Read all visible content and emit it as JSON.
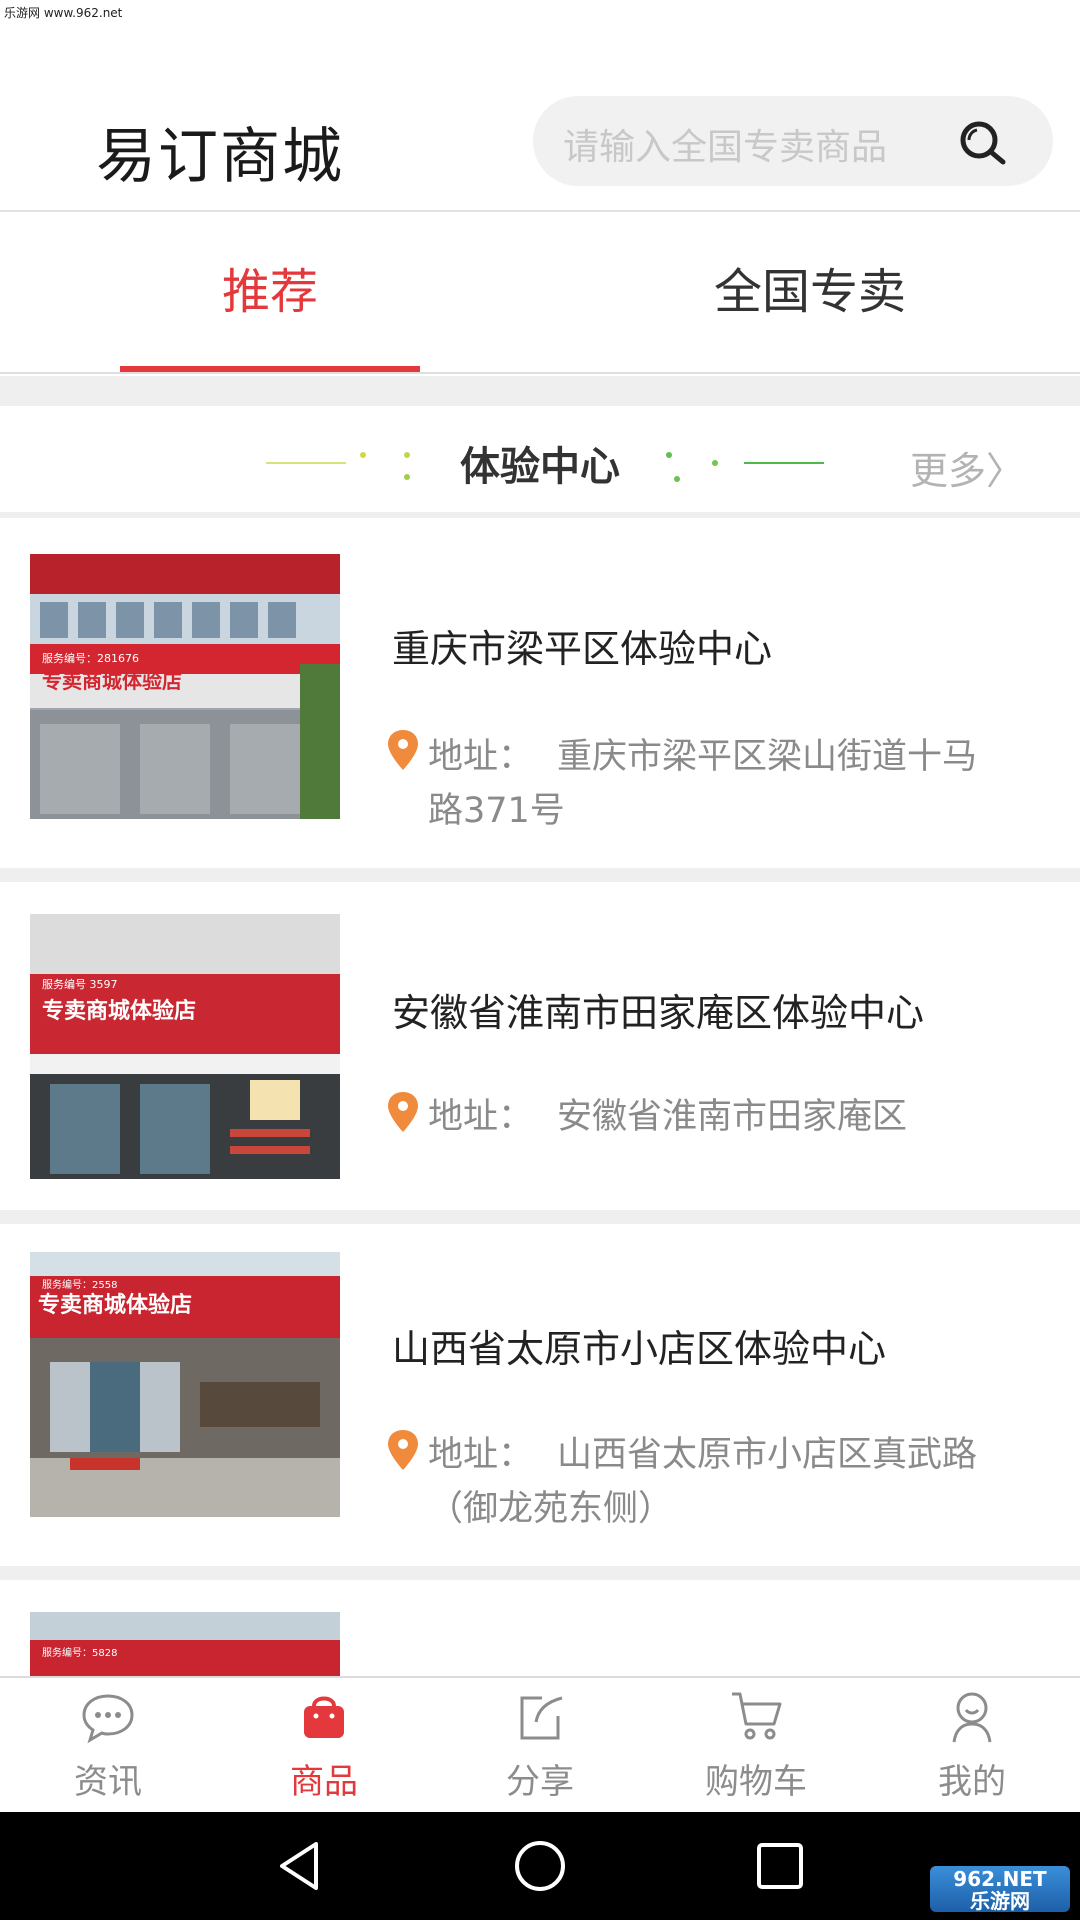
{
  "watermark": {
    "top": "乐游网 www.962.net",
    "bottom_line1": "962.NET",
    "bottom_line2": "乐游网"
  },
  "header": {
    "logo": "易订商城",
    "search_placeholder": "请输入全国专卖商品"
  },
  "tabs": [
    {
      "label": "推荐",
      "active": true
    },
    {
      "label": "全国专卖",
      "active": false
    }
  ],
  "section": {
    "title": "体验中心",
    "more": "更多〉"
  },
  "stores": [
    {
      "name": "重庆市梁平区体验中心",
      "address_label": "地址：",
      "address_line1": "重庆市梁平区梁山街道十马",
      "address_line2": "路371号",
      "sign": "专卖商城体验店",
      "service_no": "服务编号：281676"
    },
    {
      "name": "安徽省淮南市田家庵区体验中心",
      "address_label": "地址：",
      "address_line1": "安徽省淮南市田家庵区",
      "address_line2": "",
      "sign": "专卖商城体验店",
      "service_no": "服务编号 3597"
    },
    {
      "name": "山西省太原市小店区体验中心",
      "address_label": "地址：",
      "address_line1": "山西省太原市小店区真武路",
      "address_line2": "（御龙苑东侧）",
      "sign": "专卖商城体验店",
      "service_no": "服务编号：2558"
    },
    {
      "service_no": "服务编号：5828"
    }
  ],
  "bottom_nav": [
    {
      "label": "资讯",
      "icon": "chat-bubble-icon",
      "active": false
    },
    {
      "label": "商品",
      "icon": "shopping-bag-icon",
      "active": true
    },
    {
      "label": "分享",
      "icon": "share-icon",
      "active": false
    },
    {
      "label": "购物车",
      "icon": "cart-icon",
      "active": false
    },
    {
      "label": "我的",
      "icon": "user-icon",
      "active": false
    }
  ],
  "colors": {
    "accent": "#e4393c",
    "pin": "#f08a3c",
    "gray_text": "#8a8a8a"
  }
}
